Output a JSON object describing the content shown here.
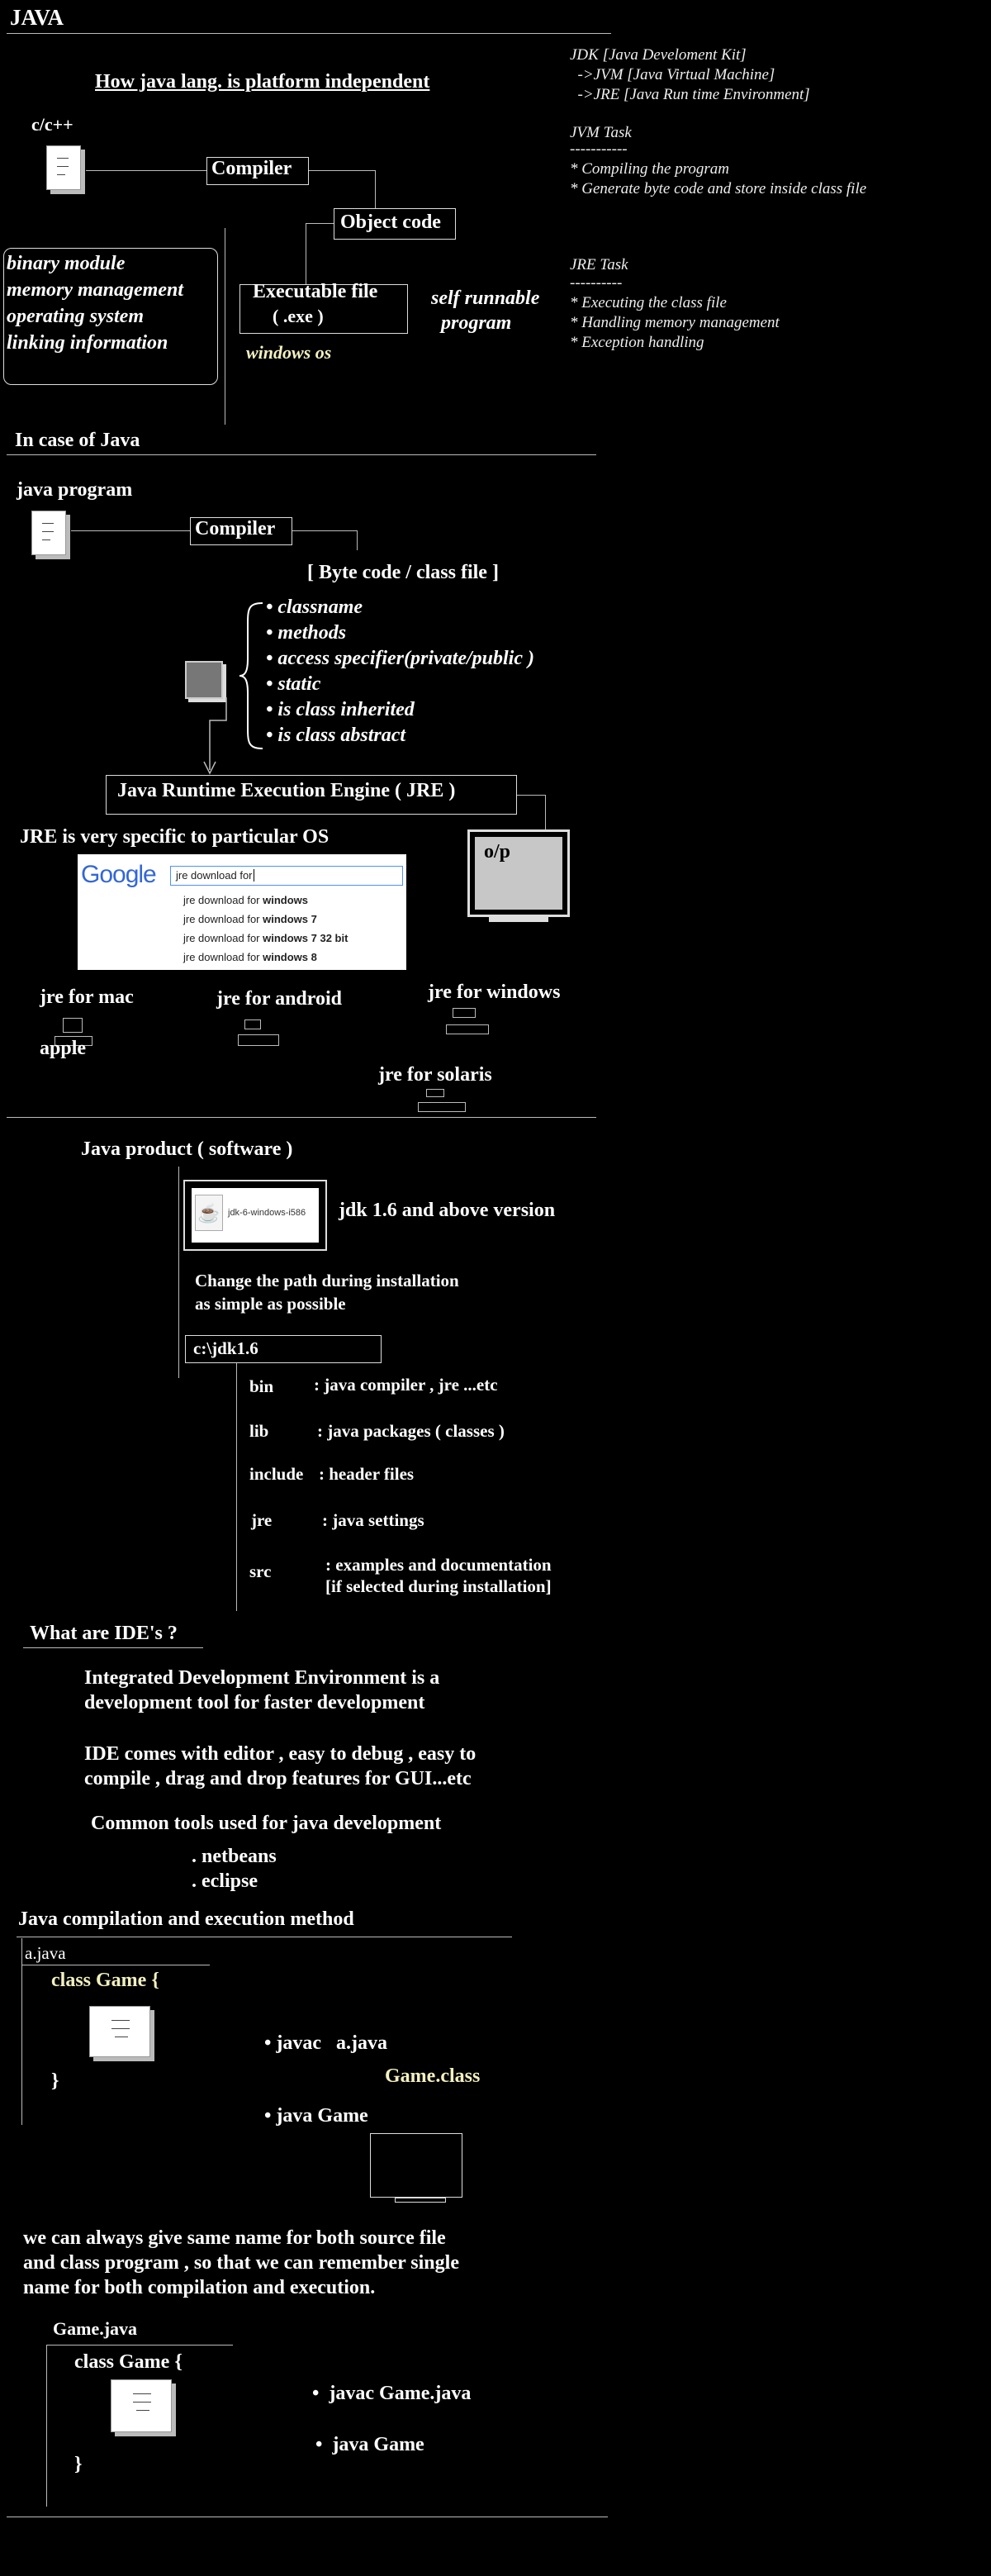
{
  "header": {
    "title": "JAVA"
  },
  "section1": {
    "title": "How java lang. is platform independent",
    "lang_label": "c/c++",
    "compiler": "Compiler",
    "object_code": "Object code",
    "exe_line1": "Executable file",
    "exe_line2": "( .exe )",
    "self_runnable": [
      "self runnable",
      "program"
    ],
    "windows_os": "windows os",
    "exe_contents": [
      "binary module",
      "memory management",
      "operating system",
      "linking information"
    ]
  },
  "notes": {
    "jdk": [
      "JDK [Java Develoment Kit]",
      "  ->JVM [Java Virtual Machine]",
      "  ->JRE [Java Run time Environment]"
    ],
    "jvm_title": "JVM Task",
    "jvm_sep": "-----------",
    "jvm_tasks": [
      "* Compiling the program",
      "* Generate byte code and store inside class file"
    ],
    "jre_title": "JRE Task",
    "jre_sep": "----------",
    "jre_tasks": [
      "* Executing the class file",
      "* Handling memory management",
      "* Exception handling"
    ]
  },
  "section2": {
    "title": "In case of Java",
    "java_program": "java program",
    "compiler": "Compiler",
    "bytecode": "[ Byte code  / class file ]",
    "class_info": [
      "classname",
      "methods",
      "access specifier(private/public )",
      "static",
      "is class inherited",
      "is class abstract"
    ],
    "jre_engine": "Java Runtime Execution Engine ( JRE )",
    "op": "o/p",
    "jre_specific": "JRE is very specific to particular OS",
    "google": {
      "logo": "Google",
      "query": "jre download for",
      "suggestions": [
        {
          "prefix": "jre download for ",
          "bold": "windows"
        },
        {
          "prefix": "jre download for ",
          "bold": "windows 7"
        },
        {
          "prefix": "jre download for ",
          "bold": "windows 7 32 bit"
        },
        {
          "prefix": "jre download for ",
          "bold": "windows 8"
        }
      ]
    },
    "jre_mac": "jre for mac",
    "apple": "apple",
    "jre_android": "jre for android",
    "jre_windows": "jre for windows",
    "jre_solaris": "jre for solaris"
  },
  "section3": {
    "title": "Java product ( software )",
    "installer_name": "jdk-6-windows-i586",
    "jdk_version": "jdk 1.6 and above version",
    "path_note": [
      "Change the path during installation",
      "as simple as possible"
    ],
    "path": "c:\\jdk1.6",
    "folders": [
      {
        "name": "bin",
        "desc": ": java compiler , jre ...etc"
      },
      {
        "name": "lib",
        "desc": ": java packages ( classes )"
      },
      {
        "name": "include",
        "desc": ": header files"
      },
      {
        "name": "jre",
        "desc": ": java settings"
      },
      {
        "name": "src",
        "desc": ": examples and documentation"
      }
    ],
    "src_extra": "[if selected during installation]"
  },
  "section4": {
    "title": "What are IDE's ?",
    "para1": [
      "Integrated Development Environment is a",
      "development tool for faster development"
    ],
    "para2": [
      "IDE comes with editor , easy to debug , easy to",
      "compile , drag and drop features for GUI...etc"
    ],
    "tools_title": "Common tools used for java development",
    "tools": [
      ". netbeans",
      ". eclipse"
    ]
  },
  "section5": {
    "title": "Java compilation and execution method",
    "file": "a.java",
    "class_open": "class Game {",
    "class_close": "}",
    "cmd1": "javac   a.java",
    "output_class": "Game.class",
    "cmd2": "java Game"
  },
  "section6": {
    "note": [
      "we can always give same name for both source file",
      "and class program , so that we can remember single",
      "name for both compilation and execution."
    ],
    "file": "Game.java",
    "class_open": "class Game {",
    "class_close": "}",
    "cmd1": "javac Game.java",
    "cmd2": "java Game"
  },
  "colors": {
    "background": "#000000",
    "text": "#ffffff",
    "accent_yellow": "#f3f0c0",
    "line": "#bbbbbb"
  }
}
